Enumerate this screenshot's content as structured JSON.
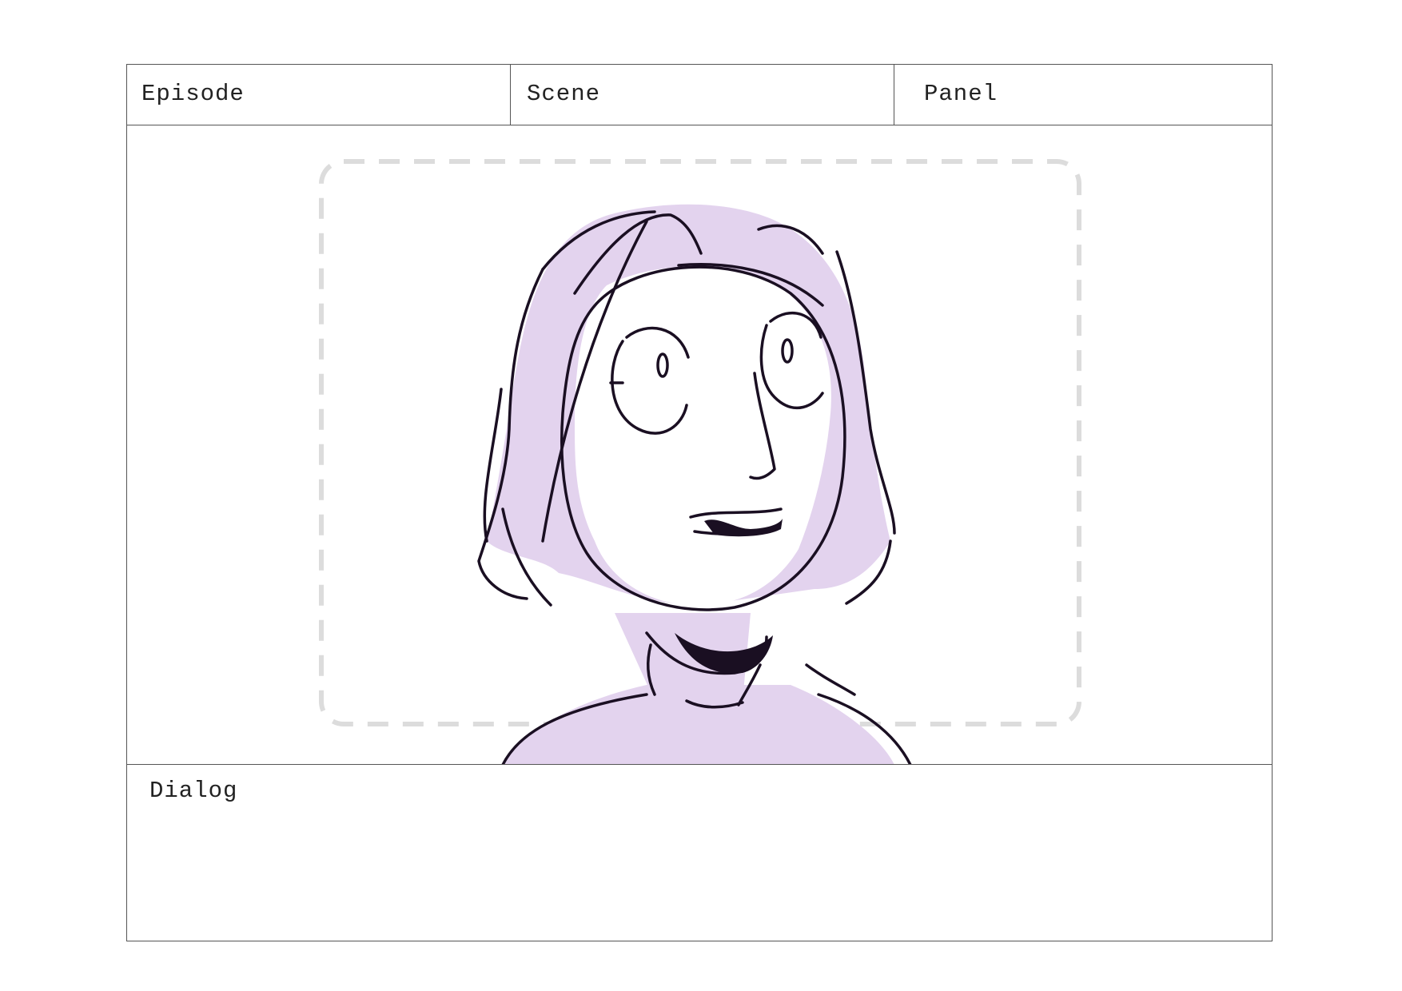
{
  "header": {
    "episode_label": "Episode",
    "scene_label": "Scene",
    "panel_label": "Panel"
  },
  "frame": {
    "safe_area_color": "#dcdcdc",
    "hair_color": "#e3d3ee",
    "line_color": "#1a0f22"
  },
  "dialog": {
    "label": "Dialog"
  }
}
